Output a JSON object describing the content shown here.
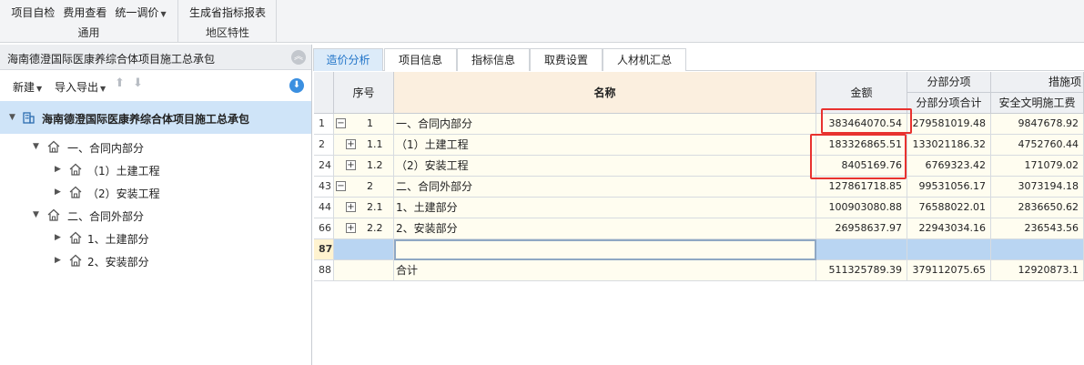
{
  "ribbon": {
    "group_common": {
      "buttons": [
        "项目自检",
        "费用查看",
        "统一调价"
      ],
      "label": "通用"
    },
    "group_region": {
      "buttons": [
        "生成省指标报表"
      ],
      "label": "地区特性"
    }
  },
  "left_panel": {
    "title": "海南德澄国际医康养综合体项目施工总承包",
    "new_label": "新建",
    "import_export_label": "导入导出",
    "tree": [
      {
        "label": "海南德澄国际医康养综合体项目施工总承包",
        "level": 0,
        "selected": true
      },
      {
        "label": "一、合同内部分",
        "level": 1,
        "expanded": true
      },
      {
        "label": "（1）土建工程",
        "level": 2
      },
      {
        "label": "（2）安装工程",
        "level": 2
      },
      {
        "label": "二、合同外部分",
        "level": 1,
        "expanded": true
      },
      {
        "label": "1、土建部分",
        "level": 2
      },
      {
        "label": "2、安装部分",
        "level": 2
      }
    ]
  },
  "tabs": [
    {
      "label": "造价分析",
      "active": true
    },
    {
      "label": "项目信息",
      "active": false
    },
    {
      "label": "指标信息",
      "active": false
    },
    {
      "label": "取费设置",
      "active": false
    },
    {
      "label": "人材机汇总",
      "active": false
    }
  ],
  "grid": {
    "headers": {
      "seq": "序号",
      "name": "名称",
      "amount": "金额",
      "sub_group": "分部分项",
      "sub_total": "分部分项合计",
      "measure_group": "措施项",
      "safety": "安全文明施工费"
    },
    "rows": [
      {
        "rownum": "1",
        "expander": "−",
        "seq": "1",
        "name": "一、合同内部分",
        "amount": "383464070.54",
        "sub_total": "279581019.48",
        "safety": "9847678.92"
      },
      {
        "rownum": "2",
        "expander": "+",
        "seq": "1.1",
        "name": "（1）土建工程",
        "amount": "183326865.51",
        "sub_total": "133021186.32",
        "safety": "4752760.44"
      },
      {
        "rownum": "24",
        "expander": "+",
        "seq": "1.2",
        "name": "（2）安装工程",
        "amount": "8405169.76",
        "sub_total": "6769323.42",
        "safety": "171079.02"
      },
      {
        "rownum": "43",
        "expander": "−",
        "seq": "2",
        "name": "二、合同外部分",
        "amount": "127861718.85",
        "sub_total": "99531056.17",
        "safety": "3073194.18"
      },
      {
        "rownum": "44",
        "expander": "+",
        "seq": "2.1",
        "name": "1、土建部分",
        "amount": "100903080.88",
        "sub_total": "76588022.01",
        "safety": "2836650.62"
      },
      {
        "rownum": "66",
        "expander": "+",
        "seq": "2.2",
        "name": "2、安装部分",
        "amount": "26958637.97",
        "sub_total": "22943034.16",
        "safety": "236543.56"
      },
      {
        "rownum": "87",
        "expander": "",
        "seq": "",
        "name": "",
        "amount": "",
        "sub_total": "",
        "safety": ""
      },
      {
        "rownum": "88",
        "expander": "",
        "seq": "",
        "name": "合计",
        "amount": "511325789.39",
        "sub_total": "379112075.65",
        "safety": "12920873.1"
      }
    ]
  },
  "colors": {
    "accent": "#1f73c8",
    "highlight_box": "#e8322f",
    "selection": "#b9d5f2"
  }
}
